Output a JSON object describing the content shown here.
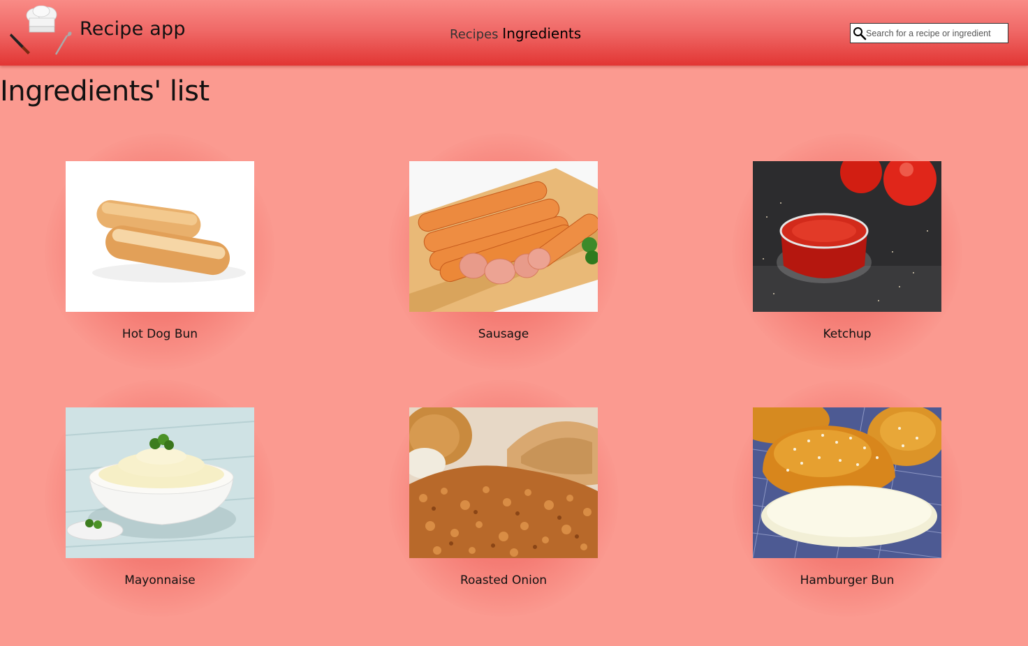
{
  "header": {
    "app_title": "Recipe app",
    "logo_icon": "chef-hat-knife-ladle-icon",
    "nav": {
      "recipes_label": "Recipes",
      "ingredients_label": "Ingredients",
      "active": "ingredients"
    },
    "search": {
      "placeholder": "Search for a recipe or ingredient",
      "value": "",
      "icon": "search-icon"
    }
  },
  "page": {
    "title": "Ingredients' list"
  },
  "ingredients": [
    {
      "name": "Hot Dog Bun",
      "image_icon": "hot-dog-bun-image"
    },
    {
      "name": "Sausage",
      "image_icon": "sausage-image"
    },
    {
      "name": "Ketchup",
      "image_icon": "ketchup-image"
    },
    {
      "name": "Mayonnaise",
      "image_icon": "mayonnaise-image"
    },
    {
      "name": "Roasted Onion",
      "image_icon": "roasted-onion-image"
    },
    {
      "name": "Hamburger Bun",
      "image_icon": "hamburger-bun-image"
    }
  ],
  "colors": {
    "background": "#fb9a90",
    "header_top": "#f98b86",
    "header_bottom": "#e23634",
    "card_glow": "#e43734"
  }
}
